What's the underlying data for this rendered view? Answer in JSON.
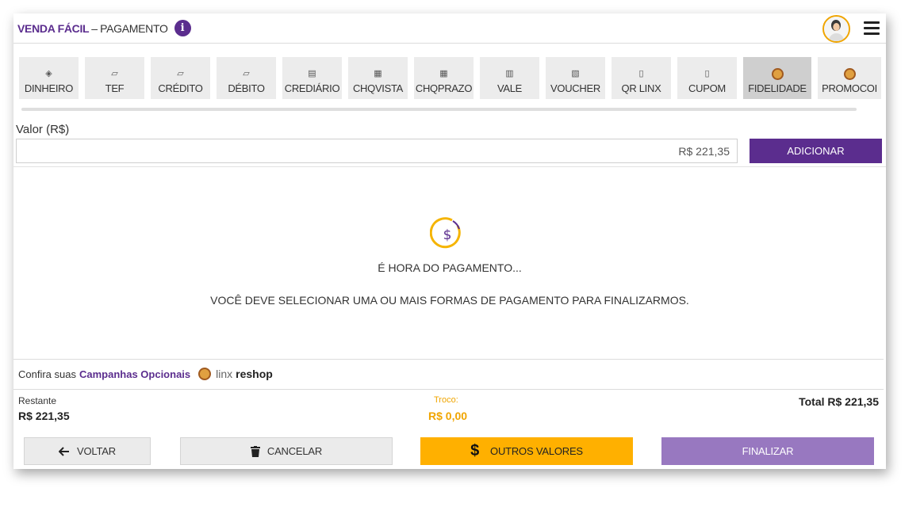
{
  "header": {
    "brand": "VENDA FÁCIL",
    "separator": "–",
    "page": "PAGAMENTO",
    "info_icon": "info-icon",
    "menu_icon": "hamburger-menu-icon"
  },
  "methods": [
    {
      "label": "DINHEIRO",
      "icon": "money-icon"
    },
    {
      "label": "TEF",
      "icon": "card-icon"
    },
    {
      "label": "CRÉDITO",
      "icon": "card-icon"
    },
    {
      "label": "DÉBITO",
      "icon": "card-icon"
    },
    {
      "label": "CREDIÁRIO",
      "icon": "cash-stack-icon"
    },
    {
      "label": "CHQVISTA",
      "icon": "check-icon"
    },
    {
      "label": "CHQPRAZO",
      "icon": "check-icon"
    },
    {
      "label": "VALE",
      "icon": "voucher-icon"
    },
    {
      "label": "VOUCHER",
      "icon": "hand-money-icon"
    },
    {
      "label": "QR LINX",
      "icon": "phone-icon"
    },
    {
      "label": "CUPOM",
      "icon": "coupon-icon"
    },
    {
      "label": "FIDELIDADE",
      "icon": "reshop-coin-icon",
      "active": true
    },
    {
      "label": "PROMOCOI",
      "icon": "reshop-coin-icon"
    }
  ],
  "valor": {
    "label": "Valor (R$)",
    "value": "R$ 221,35",
    "add_label": "ADICIONAR"
  },
  "empty_state": {
    "icon": "dollar-circle-icon",
    "title": "É HORA DO PAGAMENTO...",
    "message": "VOCÊ DEVE SELECIONAR UMA OU MAIS FORMAS DE PAGAMENTO PARA FINALIZARMOS."
  },
  "campaign": {
    "prefix": "Confira suas",
    "link": "Campanhas Opcionais",
    "logo_linx": "linx",
    "logo_reshop": "reshop"
  },
  "totals": {
    "restante_label": "Restante",
    "restante_value": "R$ 221,35",
    "troco_label": "Troco:",
    "troco_value": "R$ 0,00",
    "total": "Total R$ 221,35"
  },
  "buttons": {
    "voltar": "VOLTAR",
    "cancelar": "CANCELAR",
    "outros": "OUTROS VALORES",
    "finalizar": "FINALIZAR"
  },
  "colors": {
    "primary": "#5b2d8e",
    "accent": "#ffb000",
    "finalize": "#9878c0"
  }
}
